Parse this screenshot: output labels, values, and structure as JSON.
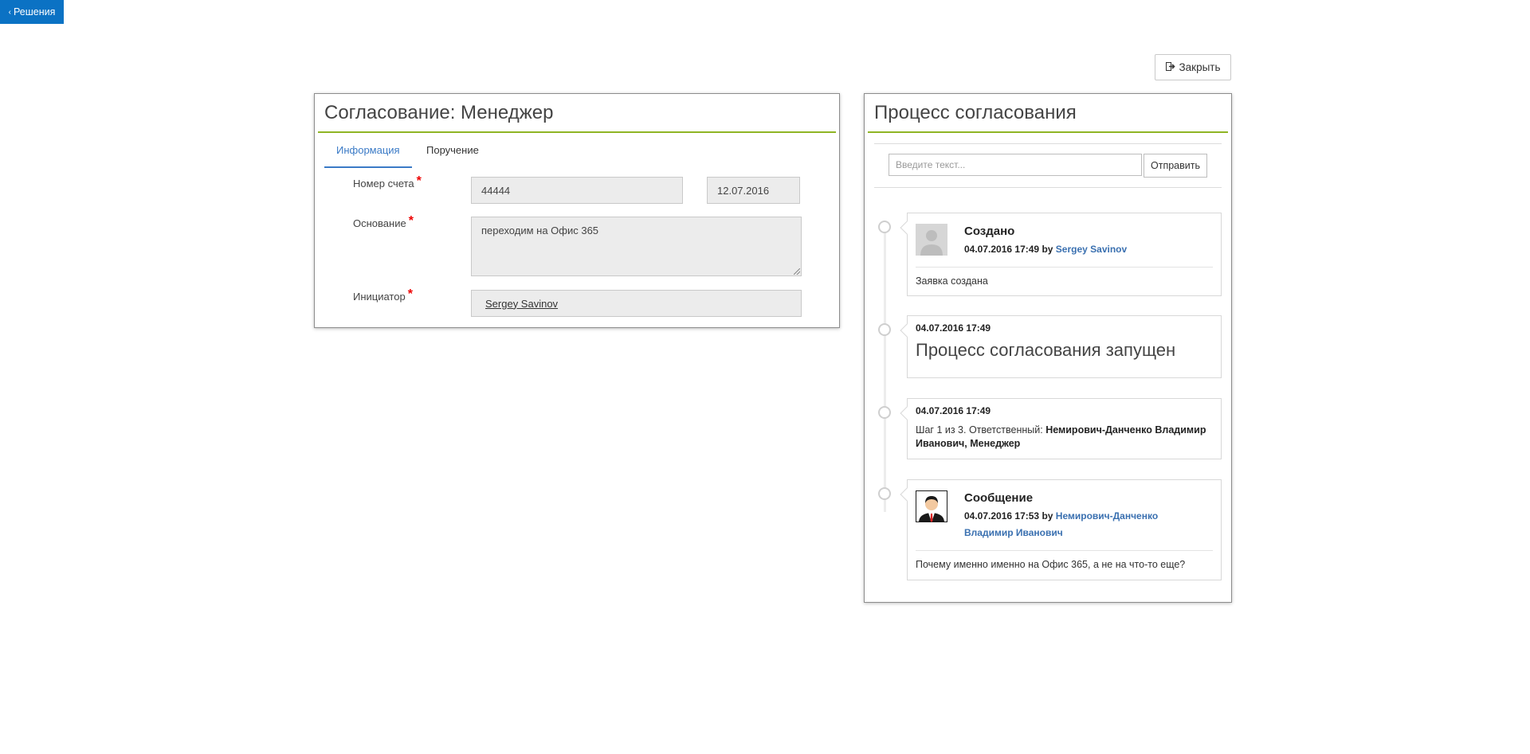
{
  "nav": {
    "back_label": "Решения"
  },
  "toolbar": {
    "close_label": "Закрыть"
  },
  "form": {
    "title": "Согласование: Менеджер",
    "tabs": [
      {
        "label": "Информация",
        "active": true
      },
      {
        "label": "Поручение",
        "active": false
      }
    ],
    "required_mark": "*",
    "fields": {
      "account_number": {
        "label": "Номер счета",
        "value": "44444",
        "date": "12.07.2016"
      },
      "reason": {
        "label": "Основание",
        "value": "переходим на Офис 365"
      },
      "initiator": {
        "label": "Инициатор",
        "value": "Sergey Savinov"
      }
    }
  },
  "process": {
    "title": "Процесс согласования",
    "input_placeholder": "Введите текст...",
    "send_label": "Отправить",
    "accent_color": "#8fb524",
    "events": [
      {
        "title": "Создано",
        "timestamp": "04.07.2016 17:49",
        "by": "by",
        "author": "Sergey Savinov",
        "text": "Заявка создана",
        "avatar": "default-user-avatar"
      },
      {
        "timestamp": "04.07.2016 17:49",
        "text": "Процесс согласования запущен"
      },
      {
        "timestamp": "04.07.2016 17:49",
        "step_prefix": "Шаг 1 из 3. Ответственный:",
        "step_person": "Немирович-Данченко Владимир Иванович, Менеджер"
      },
      {
        "title": "Сообщение",
        "timestamp": "04.07.2016 17:53",
        "by": "by",
        "author_line1": "Немирович-Данченко",
        "author_line2": "Владимир Иванович",
        "text": "Почему именно именно на Офис 365, а не на что-то еще?",
        "avatar": "manager-avatar"
      }
    ]
  }
}
